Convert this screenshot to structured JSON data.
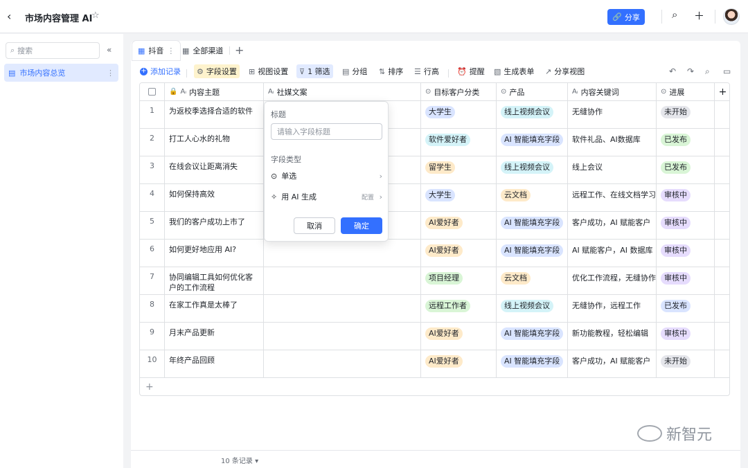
{
  "topbar": {
    "title": "市场内容管理 AI",
    "share_label": "分享"
  },
  "sidebar": {
    "search_placeholder": "搜索",
    "items": [
      {
        "label": "市场内容总览"
      }
    ]
  },
  "tabs": [
    {
      "label": "抖音"
    },
    {
      "label": "全部渠道"
    }
  ],
  "toolbar": {
    "add_record": "添加记录",
    "field_settings": "字段设置",
    "view_settings": "视图设置",
    "filter": "1 筛选",
    "group": "分组",
    "sort": "排序",
    "row_height": "行高",
    "reminder": "提醒",
    "generate_form": "生成表单",
    "share_view": "分享视图"
  },
  "table": {
    "columns": [
      "内容主题",
      "社媒文案",
      "目标客户分类",
      "产品",
      "内容关键词",
      "进展"
    ],
    "rows": [
      {
        "num": "1",
        "topic": "为返校季选择合适的软件",
        "customer": "大学生",
        "customer_color": "blue",
        "product": "线上视频会议",
        "product_color": "cyan",
        "keywords": "无缝协作",
        "status": "未开始",
        "status_color": "gray"
      },
      {
        "num": "2",
        "topic": "打工人心水的礼物",
        "customer": "软件爱好者",
        "customer_color": "cyan",
        "product": "AI 智能填充字段",
        "product_color": "blue",
        "keywords": "软件礼品、AI数据库",
        "status": "已发布",
        "status_color": "green"
      },
      {
        "num": "3",
        "topic": "在线会议让距离消失",
        "customer": "留学生",
        "customer_color": "orange",
        "product": "线上视频会议",
        "product_color": "cyan",
        "keywords": "线上会议",
        "status": "已发布",
        "status_color": "green"
      },
      {
        "num": "4",
        "topic": "如何保持高效",
        "customer": "大学生",
        "customer_color": "blue",
        "product": "云文档",
        "product_color": "orange",
        "keywords": "远程工作、在线文档学习",
        "status": "审核中",
        "status_color": "purple"
      },
      {
        "num": "5",
        "topic": "我们的客户成功上市了",
        "customer": "AI爱好者",
        "customer_color": "orange",
        "product": "AI 智能填充字段",
        "product_color": "blue",
        "keywords": "客户成功，AI 赋能客户",
        "status": "审核中",
        "status_color": "purple"
      },
      {
        "num": "6",
        "topic": "如何更好地应用 AI?",
        "customer": "AI爱好者",
        "customer_color": "orange",
        "product": "AI 智能填充字段",
        "product_color": "blue",
        "keywords": "AI 赋能客户，AI 数据库",
        "status": "审核中",
        "status_color": "purple"
      },
      {
        "num": "7",
        "topic": "协同编辑工具如何优化客户的工作流程",
        "customer": "项目经理",
        "customer_color": "green",
        "product": "云文档",
        "product_color": "orange",
        "keywords": "优化工作流程，无缝协作",
        "status": "审核中",
        "status_color": "purple"
      },
      {
        "num": "8",
        "topic": "在家工作真是太棒了",
        "customer": "远程工作者",
        "customer_color": "green",
        "product": "线上视频会议",
        "product_color": "cyan",
        "keywords": "无缝协作，远程工作",
        "status": "已发布",
        "status_color": "blue"
      },
      {
        "num": "9",
        "topic": "月末产品更新",
        "customer": "AI爱好者",
        "customer_color": "orange",
        "product": "AI 智能填充字段",
        "product_color": "blue",
        "keywords": "新功能教程，轻松编辑",
        "status": "审核中",
        "status_color": "purple"
      },
      {
        "num": "10",
        "topic": "年终产品回顾",
        "customer": "AI爱好者",
        "customer_color": "orange",
        "product": "AI 智能填充字段",
        "product_color": "blue",
        "keywords": "客户成功，AI 赋能客户",
        "status": "未开始",
        "status_color": "gray"
      }
    ]
  },
  "footer": {
    "record_count": "10 条记录"
  },
  "popup": {
    "title_label": "标题",
    "title_placeholder": "请输入字段标题",
    "field_type_label": "字段类型",
    "type_single": "单选",
    "type_ai": "用 AI 生成",
    "config_label": "配置",
    "cancel": "取消",
    "confirm": "确定"
  },
  "watermark": {
    "text": "新智元"
  }
}
